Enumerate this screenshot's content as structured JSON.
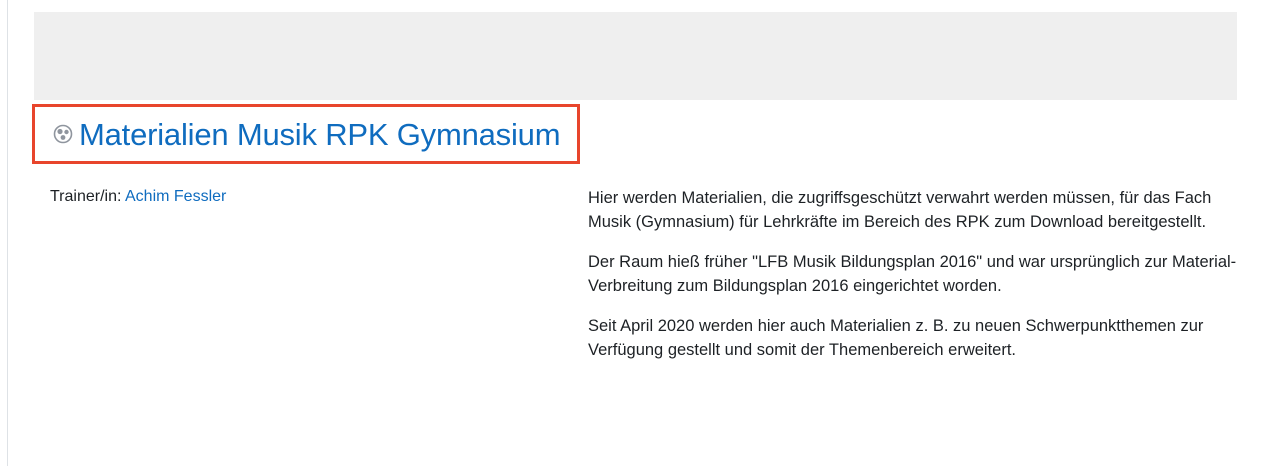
{
  "course": {
    "title": "Materialien Musik RPK Gymnasium",
    "icon": "course-icon",
    "colors": {
      "link": "#0f6cbf",
      "highlight_border": "#e8452c",
      "banner": "#efefef"
    }
  },
  "teacher": {
    "label": "Trainer/in:",
    "name": "Achim Fessler"
  },
  "summary": {
    "paragraphs": [
      "Hier werden Materialien, die zugriffsgeschützt verwahrt werden müssen, für das Fach Musik (Gymnasium) für Lehrkräfte im Bereich des RPK zum Download bereitgestellt.",
      "Der Raum hieß früher \"LFB Musik Bildungsplan 2016\" und war ursprünglich zur Material-Verbreitung zum Bildungsplan 2016 eingerichtet worden.",
      "Seit April 2020 werden hier auch Materialien z. B. zu neuen Schwerpunktthemen zur Verfügung gestellt und somit der Themenbereich erweitert."
    ]
  }
}
